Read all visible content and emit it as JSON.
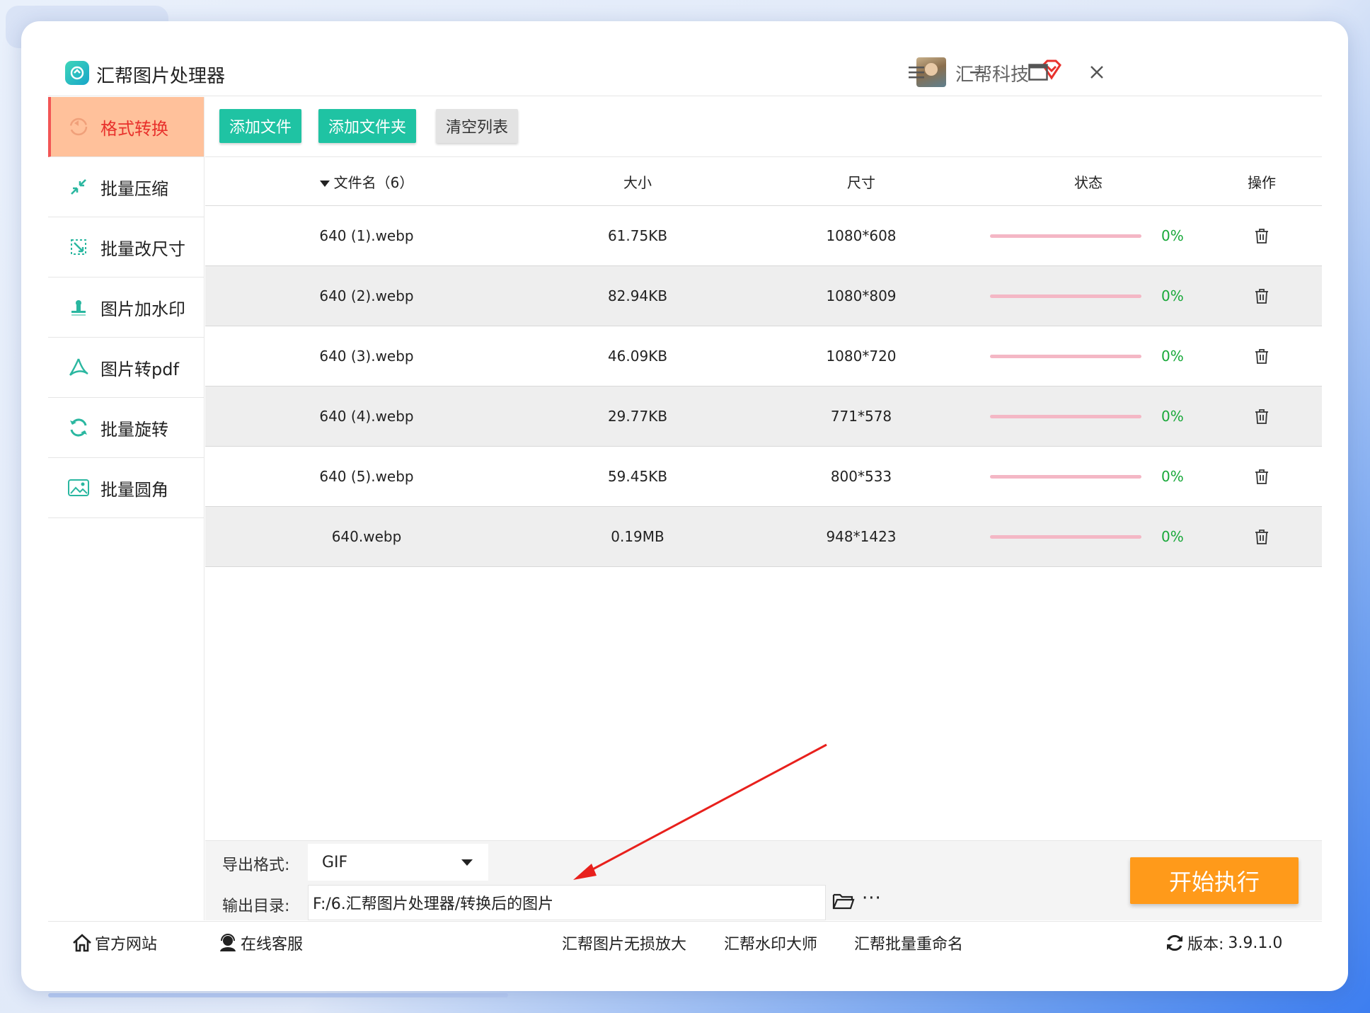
{
  "app": {
    "title": "汇帮图片处理器",
    "user_name": "汇帮科技",
    "window_controls": [
      "menu-icon",
      "minimize-icon",
      "maximize-icon",
      "close-icon"
    ]
  },
  "sidebar": {
    "items": [
      {
        "label": "格式转换",
        "icon": "convert-icon",
        "active": true
      },
      {
        "label": "批量压缩",
        "icon": "compress-icon",
        "active": false
      },
      {
        "label": "批量改尺寸",
        "icon": "resize-icon",
        "active": false
      },
      {
        "label": "图片加水印",
        "icon": "watermark-icon",
        "active": false
      },
      {
        "label": "图片转pdf",
        "icon": "pdf-icon",
        "active": false
      },
      {
        "label": "批量旋转",
        "icon": "rotate-icon",
        "active": false
      },
      {
        "label": "批量圆角",
        "icon": "round-corner-icon",
        "active": false
      }
    ]
  },
  "toolbar": {
    "add_file": "添加文件",
    "add_folder": "添加文件夹",
    "clear_list": "清空列表"
  },
  "table": {
    "headers": {
      "name": "文件名（6）",
      "size": "大小",
      "dimension": "尺寸",
      "status": "状态",
      "action": "操作"
    },
    "rows": [
      {
        "name": "640 (1).webp",
        "size": "61.75KB",
        "dimension": "1080*608",
        "progress": "0%"
      },
      {
        "name": "640 (2).webp",
        "size": "82.94KB",
        "dimension": "1080*809",
        "progress": "0%"
      },
      {
        "name": "640 (3).webp",
        "size": "46.09KB",
        "dimension": "1080*720",
        "progress": "0%"
      },
      {
        "name": "640 (4).webp",
        "size": "29.77KB",
        "dimension": "771*578",
        "progress": "0%"
      },
      {
        "name": "640 (5).webp",
        "size": "59.45KB",
        "dimension": "800*533",
        "progress": "0%"
      },
      {
        "name": "640.webp",
        "size": "0.19MB",
        "dimension": "948*1423",
        "progress": "0%"
      }
    ]
  },
  "settings": {
    "format_label": "导出格式:",
    "format_value": "GIF",
    "dir_label": "输出目录:",
    "dir_value": "F:/6.汇帮图片处理器/转换后的图片",
    "more": "···",
    "start": "开始执行"
  },
  "footer": {
    "website": "官方网站",
    "service": "在线客服",
    "link1": "汇帮图片无损放大",
    "link2": "汇帮水印大师",
    "link3": "汇帮批量重命名",
    "version_label": "版本:",
    "version": "3.9.1.0"
  },
  "colors": {
    "accent_green": "#1fc3a3",
    "active_bg": "#ffc19b",
    "active_text": "#e8312c",
    "start_orange": "#ff9a1a",
    "progress_pink": "#f4b7c5",
    "percent_green": "#19a83a"
  }
}
